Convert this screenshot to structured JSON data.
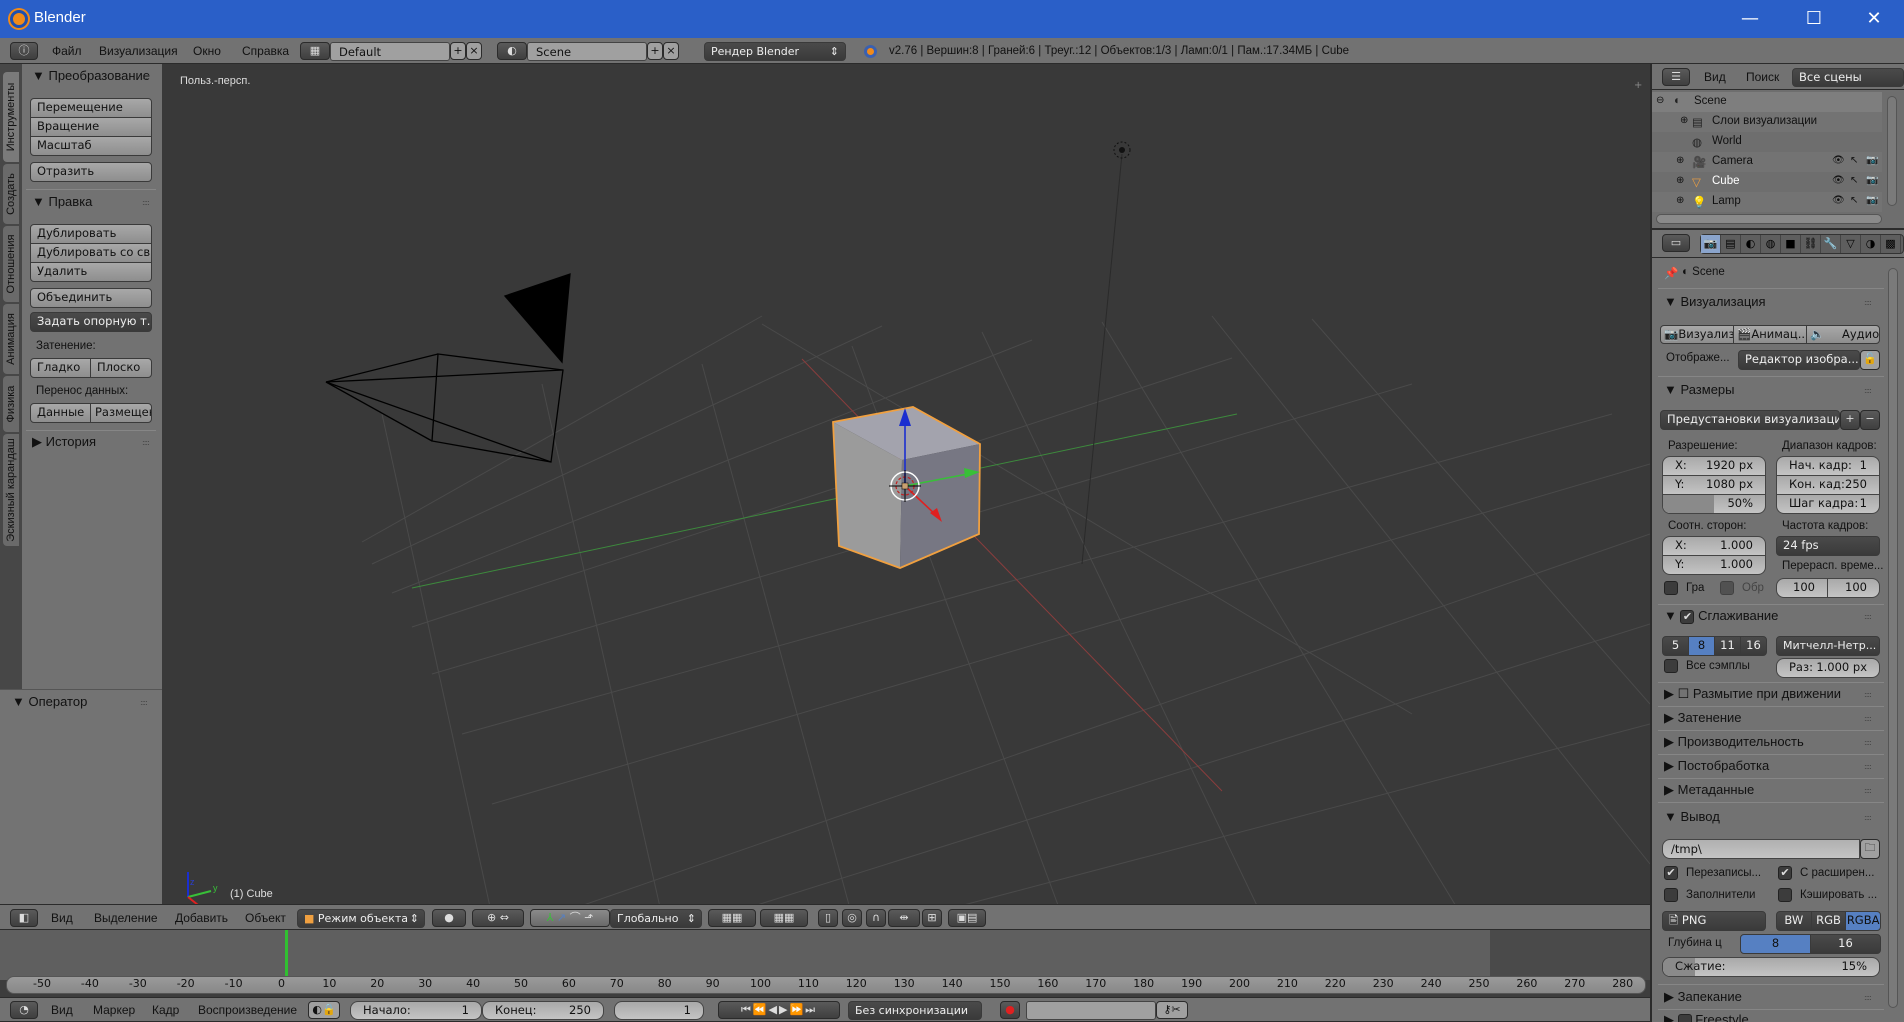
{
  "window": {
    "title": "Blender",
    "minimize": "—",
    "maximize": "☐",
    "close": "✕"
  },
  "info_header": {
    "menus": [
      "Файл",
      "Визуализация",
      "Окно",
      "Справка"
    ],
    "layout": "Default",
    "scene": "Scene",
    "render_engine": "Рендер Blender",
    "stats": "v2.76 | Вершин:8 | Граней:6 | Треуг.:12 | Объектов:1/3 | Ламп:0/1 | Пам.:17.34МБ | Cube"
  },
  "tool_shelf": {
    "tabs": [
      "Инструменты",
      "Создать",
      "Отношения",
      "Анимация",
      "Физика",
      "Эскизный карандаш"
    ],
    "transform": {
      "title": "Преобразование",
      "buttons": [
        "Перемещение",
        "Вращение",
        "Масштаб"
      ],
      "mirror": "Отразить"
    },
    "edit": {
      "title": "Правка",
      "buttons": [
        "Дублировать",
        "Дублировать со св...",
        "Удалить"
      ],
      "join": "Объединить",
      "set_origin": "Задать опорную т..."
    },
    "shading": {
      "label": "Затенение:",
      "smooth": "Гладко",
      "flat": "Плоско"
    },
    "data_transfer": {
      "label": "Перенос данных:",
      "data": "Данные",
      "layout": "Размещен"
    },
    "history": "История",
    "operator": "Оператор"
  },
  "viewport": {
    "view_name": "Польз.-персп.",
    "object_info": "(1) Cube",
    "axis_labels": {
      "x": "x",
      "y": "y",
      "z": "z"
    }
  },
  "viewport_header": {
    "menus": [
      "Вид",
      "Выделение",
      "Добавить",
      "Объект"
    ],
    "mode": "Режим объекта",
    "orientation": "Глобально"
  },
  "timeline": {
    "ticks": [
      "-50",
      "-40",
      "-30",
      "-20",
      "-10",
      "0",
      "10",
      "20",
      "30",
      "40",
      "50",
      "60",
      "70",
      "80",
      "90",
      "100",
      "110",
      "120",
      "130",
      "140",
      "150",
      "160",
      "170",
      "180",
      "190",
      "200",
      "210",
      "220",
      "230",
      "240",
      "250",
      "260",
      "270",
      "280"
    ],
    "current_frame": 1,
    "menus": [
      "Вид",
      "Маркер",
      "Кадр",
      "Воспроизведение"
    ],
    "start_label": "Начало:",
    "start": "1",
    "end_label": "Конец:",
    "end": "250",
    "frame": "1",
    "sync": "Без синхронизации"
  },
  "outliner": {
    "menus": [
      "Вид",
      "Поиск"
    ],
    "filter": "Все сцены",
    "items": [
      {
        "name": "Scene",
        "icon": "scene-icon"
      },
      {
        "name": "Слои визуализации",
        "icon": "render-layers-icon"
      },
      {
        "name": "World",
        "icon": "world-icon"
      },
      {
        "name": "Camera",
        "icon": "camera-icon"
      },
      {
        "name": "Cube",
        "icon": "mesh-icon"
      },
      {
        "name": "Lamp",
        "icon": "lamp-icon"
      }
    ]
  },
  "properties": {
    "context": "Scene",
    "render": {
      "title": "Визуализация",
      "render_btn": "Визуализ",
      "anim_btn": "Анимац...",
      "audio_btn": "Аудио",
      "display_label": "Отображе...",
      "display_value": "Редактор изобра..."
    },
    "dimensions": {
      "title": "Размеры",
      "presets": "Предустановки визуализации",
      "resolution_label": "Разрешение:",
      "res_x": "1920 px",
      "res_y": "1080 px",
      "res_pct": "50%",
      "res_pct_value": 0.5,
      "frame_range_label": "Диапазон кадров:",
      "start_label": "Нач. кадр:",
      "start": "1",
      "end_label": "Кон. кад:",
      "end": "250",
      "step_label": "Шаг кадра:",
      "step": "1",
      "aspect_label": "Соотн. сторон:",
      "aspect_x": "1.000",
      "aspect_y": "1.000",
      "fps_label": "Частота кадров:",
      "fps": "24 fps",
      "remap_label": "Перерасп. време...",
      "remap_old": "100",
      "remap_new": "100",
      "border": "Гра",
      "crop": "Обр"
    },
    "aa": {
      "title": "Сглаживание",
      "samples": [
        "5",
        "8",
        "11",
        "16"
      ],
      "selected_sample": "8",
      "filter": "Митчелл-Нетр...",
      "full_sample": "Все сэмплы",
      "size_label": "Раз:",
      "size": "1.000 px"
    },
    "collapsed": [
      "Размытие при движении",
      "Затенение",
      "Производительность",
      "Постобработка",
      "Метаданные"
    ],
    "output": {
      "title": "Вывод",
      "path": "/tmp\\",
      "overwrite": "Перезаписы...",
      "file_ext": "С расширен...",
      "placeholders": "Заполнители",
      "cache": "Кэшировать ...",
      "format": "PNG",
      "color_modes": [
        "BW",
        "RGB",
        "RGBA"
      ],
      "selected_mode": "RGBA",
      "depth_label": "Глубина ц",
      "depths": [
        "8",
        "16"
      ],
      "compression_label": "Сжатие:",
      "compression": "15%",
      "compression_value": 0.15
    },
    "bake": "Запекание",
    "freestyle": "Freestyle"
  },
  "colors": {
    "accent": "#5680c2",
    "selection": "#f0a040",
    "titlebar": "#2a5fc8"
  }
}
